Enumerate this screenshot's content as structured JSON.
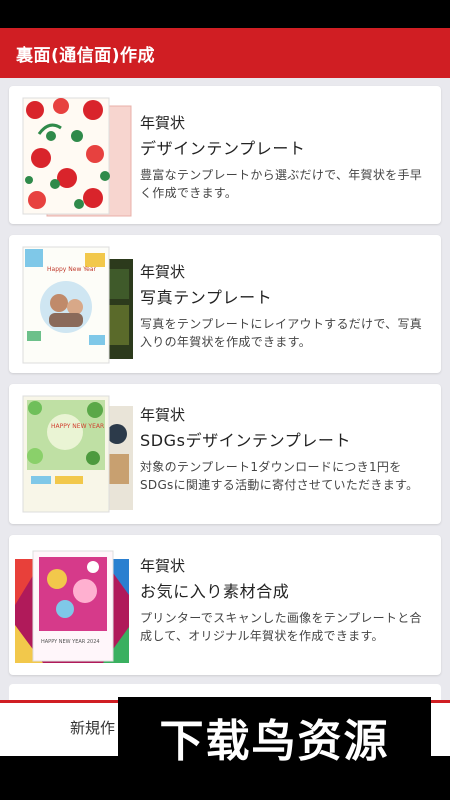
{
  "header": {
    "title": "裏面(通信面)作成"
  },
  "cards": [
    {
      "category": "年賀状",
      "name": "デザインテンプレート",
      "description": "豊富なテンプレートから選ぶだけで、年賀状を手早く作成できます。"
    },
    {
      "category": "年賀状",
      "name": "写真テンプレート",
      "description": "写真をテンプレートにレイアウトするだけで、写真入りの年賀状を作成できます。"
    },
    {
      "category": "年賀状",
      "name": "SDGsデザインテンプレート",
      "description": "対象のテンプレート1ダウンロードにつき1円をSDGsに関連する活動に寄付させていただきます。"
    },
    {
      "category": "年賀状",
      "name": "お気に入り素材合成",
      "description": "プリンターでスキャンした画像をテンプレートと合成して、オリジナル年賀状を作成できます。"
    }
  ],
  "thumb_text": {
    "photo": "Happy New Year",
    "sdgs": "HAPPY NEW YEAR",
    "fav": "HAPPY NEW YEAR 2024"
  },
  "bottom": {
    "new_label": "新規作"
  },
  "watermark": "下载鸟资源",
  "colors": {
    "accent": "#d01e23",
    "background": "#e9e9ee"
  }
}
